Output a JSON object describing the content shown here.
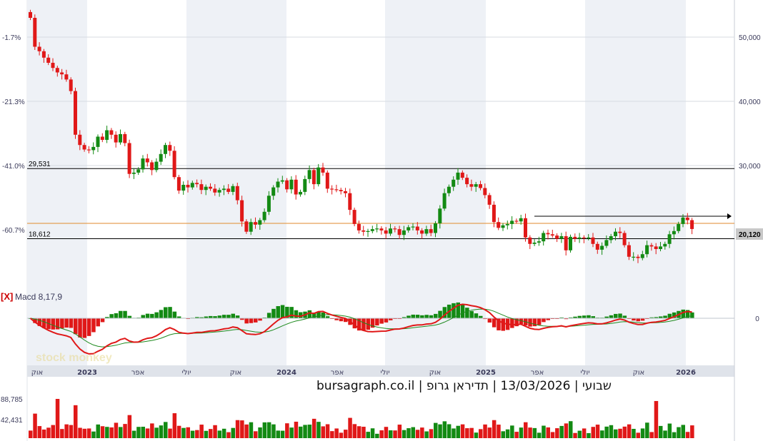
{
  "chart_data": {
    "type": "candlestick",
    "title": "שבועי | 13/03/2026 | תדיראן גרופ | bursagraph.co.il",
    "watermark": "stock monkey",
    "y_right_ticks": [
      "50,000",
      "40,000",
      "30,000"
    ],
    "y_left_pct_ticks": [
      "-1.7%",
      "-21.3%",
      "-41.0%",
      "-60.7%"
    ],
    "last_price": "20,120",
    "levels": [
      {
        "label": "29,531",
        "value": 29531,
        "color": "#000000"
      },
      {
        "label": "18,612",
        "value": 18612,
        "color": "#000000"
      },
      {
        "label": "",
        "value": 21000,
        "color": "#e08a2c"
      }
    ],
    "x_axis_labels": [
      "אוק",
      "2023",
      "אפר",
      "יולי",
      "אוק",
      "2024",
      "אפר",
      "יולי",
      "אוק",
      "2025",
      "אפר",
      "יולי",
      "אוק",
      "2026"
    ],
    "x_axis_bold": [
      false,
      true,
      false,
      false,
      false,
      true,
      false,
      false,
      false,
      true,
      false,
      false,
      false,
      true
    ],
    "macd": {
      "label": "Macd 8,17,9",
      "close_mark": "[X]",
      "zero_label": "0"
    },
    "volume": {
      "ticks": [
        "88,785",
        "42,431"
      ]
    },
    "weekly_close": [
      53000,
      48500,
      47800,
      46800,
      46000,
      45200,
      44500,
      44200,
      43400,
      41600,
      34800,
      33200,
      32500,
      32400,
      32900,
      34500,
      34000,
      35500,
      34800,
      33600,
      34900,
      33500,
      28700,
      28900,
      29400,
      31100,
      30500,
      29300,
      30600,
      31800,
      33200,
      32300,
      28200,
      26100,
      27000,
      26600,
      27300,
      27100,
      26200,
      26700,
      26400,
      25800,
      26200,
      26400,
      25900,
      26800,
      24600,
      21300,
      19700,
      21200,
      20800,
      21500,
      22800,
      25300,
      26600,
      27500,
      27700,
      26300,
      27800,
      25500,
      25900,
      27900,
      29300,
      27100,
      29700,
      28900,
      26400,
      26300,
      26200,
      26000,
      25700,
      23100,
      20900,
      19900,
      19700,
      19800,
      20100,
      20200,
      19900,
      19400,
      20200,
      20100,
      19200,
      19900,
      20400,
      20500,
      19900,
      19400,
      20100,
      19500,
      21000,
      23300,
      25700,
      26700,
      27800,
      28900,
      28100,
      27100,
      26700,
      27100,
      26500,
      25400,
      23900,
      21200,
      20300,
      20700,
      20900,
      21400,
      21300,
      21800,
      18800,
      17800,
      18000,
      18200,
      19500,
      19300,
      19100,
      18600,
      19000,
      16800,
      18900,
      18600,
      18800,
      18700,
      18800,
      17800,
      16900,
      17500,
      18400,
      19000,
      19700,
      19500,
      17600,
      15800,
      15800,
      15600,
      16200,
      17600,
      17400,
      17000,
      17400,
      17800,
      19300,
      19800,
      20900,
      21900,
      21500,
      20120
    ]
  }
}
